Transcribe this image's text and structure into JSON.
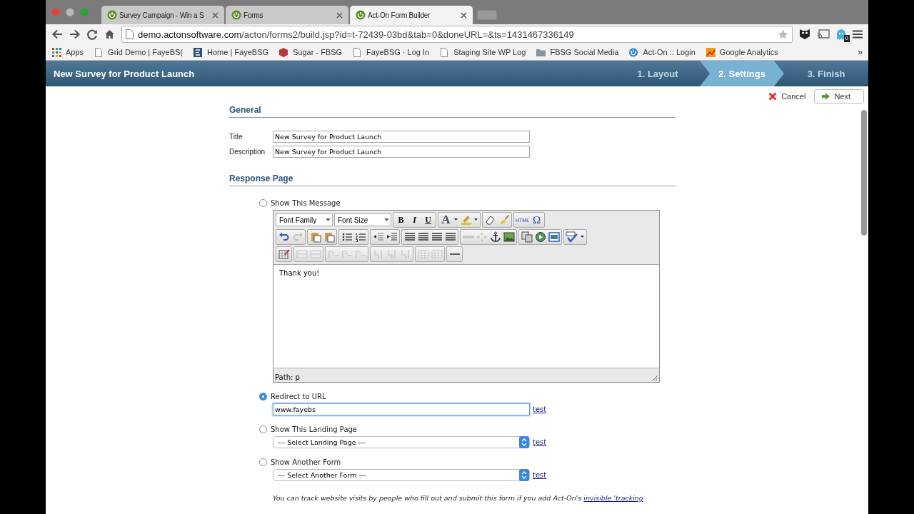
{
  "browser": {
    "tabs": [
      {
        "label": "Survey Campaign - Win a S",
        "selected": false
      },
      {
        "label": "Forms",
        "selected": false
      },
      {
        "label": "Act-On Form Builder",
        "selected": true
      }
    ],
    "address": {
      "host": "demo.actonsoftware.com",
      "path": "/acton/forms2/build.jsp?id=t-72439-03bd&tab=0&doneURL=&ts=1431467336149"
    },
    "extension_badge": "0",
    "bookmarks": [
      {
        "kind": "apps",
        "label": "Apps"
      },
      {
        "kind": "page",
        "label": "Grid Demo | FayeBS("
      },
      {
        "kind": "logo",
        "label": "Home | FayeBSG"
      },
      {
        "kind": "cube",
        "label": "Sugar - FBSG"
      },
      {
        "kind": "page",
        "label": "FayeBSG · Log In"
      },
      {
        "kind": "page",
        "label": "Staging Site WP Log"
      },
      {
        "kind": "folder",
        "label": "FBSG Social Media"
      },
      {
        "kind": "power",
        "label": "Act-On :: Login"
      },
      {
        "kind": "chart",
        "label": "Google Analytics"
      }
    ],
    "more_bookmarks": "»"
  },
  "header": {
    "title": "New Survey for Product Launch",
    "steps": [
      {
        "label": "1. Layout",
        "selected": false
      },
      {
        "label": "2. Settings",
        "selected": true
      },
      {
        "label": "3. Finish",
        "selected": false
      }
    ]
  },
  "actions": {
    "cancel": "Cancel",
    "next": "Next"
  },
  "general": {
    "heading": "General",
    "fields": [
      {
        "label": "Title",
        "value": "New Survey for Product Launch"
      },
      {
        "label": "Description",
        "value": "New Survey for Product Launch"
      }
    ]
  },
  "response": {
    "heading": "Response Page",
    "options": [
      {
        "kind": "message",
        "label": "Show This Message",
        "selected": false
      },
      {
        "kind": "url",
        "label": "Redirect to URL",
        "selected": true,
        "value": "www.fayebs",
        "test": "test"
      },
      {
        "kind": "select",
        "label": "Show This Landing Page",
        "selected": false,
        "value": "--- Select Landing Page ---",
        "test": "test"
      },
      {
        "kind": "select",
        "label": "Show Another Form",
        "selected": false,
        "value": "--- Select Another Form ---",
        "test": "test"
      }
    ],
    "editor": {
      "dropdowns": [
        "Font Family",
        "Font Size"
      ],
      "toolbar": [
        [
          [
            {
              "kind": "bold",
              "label": "B",
              "disabled": false
            },
            {
              "kind": "italic",
              "label": "I",
              "disabled": false
            },
            {
              "kind": "underline",
              "label": "U",
              "disabled": false
            }
          ],
          [
            {
              "kind": "text-color",
              "label": "A",
              "disabled": false
            },
            {
              "kind": "caret",
              "disabled": false
            },
            {
              "kind": "highlight",
              "disabled": false
            },
            {
              "kind": "caret",
              "disabled": false
            }
          ],
          [
            {
              "kind": "eraser",
              "disabled": false
            },
            {
              "kind": "brush",
              "disabled": false
            }
          ],
          [
            {
              "kind": "html",
              "label": "HTML",
              "disabled": false
            },
            {
              "kind": "omega",
              "label": "Ω",
              "disabled": false
            }
          ]
        ],
        [
          [
            {
              "kind": "undo",
              "disabled": false
            },
            {
              "kind": "redo",
              "disabled": true
            }
          ],
          [
            {
              "kind": "paste",
              "disabled": false
            },
            {
              "kind": "paste",
              "disabled": false
            }
          ],
          [
            {
              "kind": "bullets",
              "disabled": false
            },
            {
              "kind": "numbers",
              "disabled": false
            }
          ],
          [
            {
              "kind": "outdent",
              "disabled": false
            },
            {
              "kind": "indent",
              "disabled": false
            }
          ],
          [
            {
              "kind": "align",
              "disabled": false
            },
            {
              "kind": "align",
              "disabled": false
            },
            {
              "kind": "align",
              "disabled": false
            },
            {
              "kind": "align",
              "disabled": false
            }
          ],
          [
            {
              "kind": "link",
              "disabled": true
            },
            {
              "kind": "unlink",
              "disabled": true
            },
            {
              "kind": "anchor",
              "disabled": false
            },
            {
              "kind": "image",
              "disabled": false
            }
          ],
          [
            {
              "kind": "copy",
              "disabled": false
            },
            {
              "kind": "media",
              "disabled": false
            },
            {
              "kind": "layout",
              "disabled": false
            }
          ],
          [
            {
              "kind": "spellcheck",
              "disabled": false
            },
            {
              "kind": "caret",
              "disabled": false
            }
          ]
        ],
        [
          [
            {
              "kind": "table",
              "disabled": false
            }
          ],
          [
            {
              "kind": "cell",
              "disabled": true
            },
            {
              "kind": "cell",
              "disabled": true
            }
          ],
          [
            {
              "kind": "row",
              "disabled": true
            },
            {
              "kind": "row",
              "disabled": true
            },
            {
              "kind": "row",
              "disabled": true
            }
          ],
          [
            {
              "kind": "column",
              "disabled": true
            },
            {
              "kind": "column",
              "disabled": true
            },
            {
              "kind": "column",
              "disabled": true
            }
          ],
          [
            {
              "kind": "grid",
              "disabled": true
            },
            {
              "kind": "grid",
              "disabled": true
            }
          ],
          [
            {
              "kind": "rule",
              "disabled": false
            }
          ]
        ]
      ],
      "content": "Thank you!",
      "path": "Path: p"
    }
  },
  "note": {
    "text": "You can track website visits by people who fill out and submit this form if you add Act-On's",
    "link": "invisible 'tracking"
  }
}
